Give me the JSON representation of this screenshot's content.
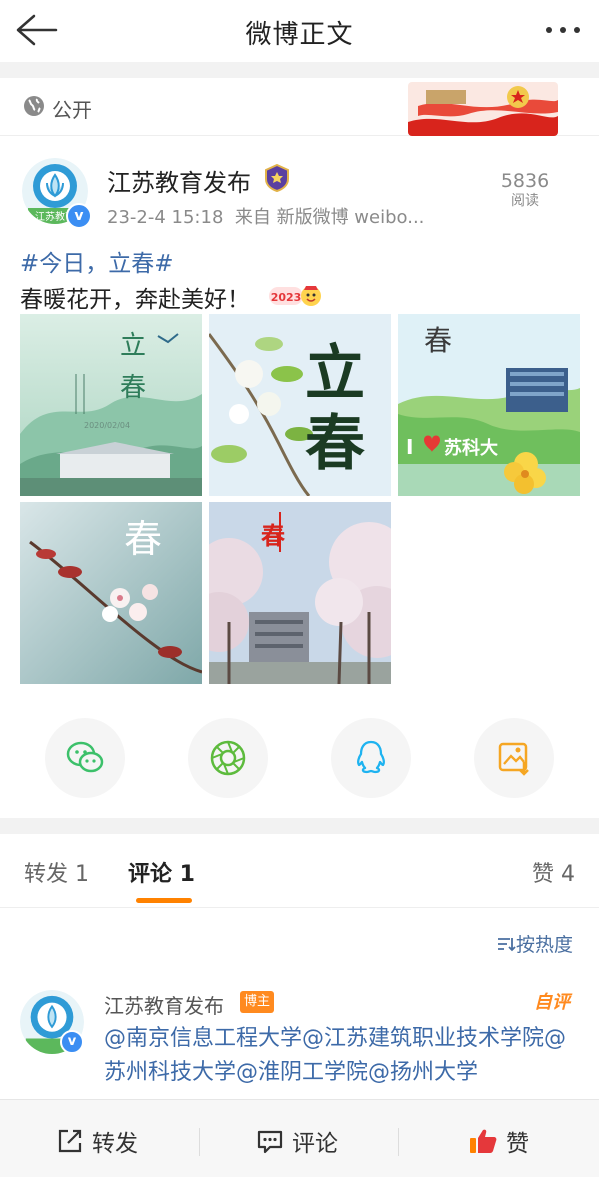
{
  "nav": {
    "title": "微博正文"
  },
  "visibility": {
    "label": "公开"
  },
  "post": {
    "author": "江苏教育发布",
    "avatar_text": "江苏教育",
    "time": "23-2-4 15:18",
    "source": "来自 新版微博 weibo...",
    "views_count": "5836",
    "views_label": "阅读",
    "topic": "#今日，立春#",
    "text": "春暖花开，奔赴美好！",
    "images": [
      {
        "big": "立",
        "big2": "春",
        "small": "2020/02/04"
      },
      {
        "big": "立",
        "big2": "春"
      },
      {
        "big": "春",
        "overlay": "苏科大"
      },
      {
        "big": "春"
      },
      {
        "big": "春"
      }
    ]
  },
  "share": [
    "wechat-icon",
    "moments-icon",
    "qq-icon",
    "save-image-icon"
  ],
  "tabs": {
    "repost": "转发 1",
    "comment": "评论 1",
    "like": "赞 4"
  },
  "sort_label": "按热度",
  "comment": {
    "author": "江苏教育发布",
    "badge": "博主",
    "self_label": "自评",
    "text": "@南京信息工程大学@江苏建筑职业技术学院@苏州科技大学@淮阴工学院@扬州大学"
  },
  "bottom": {
    "repost": "转发",
    "comment": "评论",
    "like": "赞"
  },
  "colors": {
    "accent": "#ff8200",
    "link": "#3d6aa8",
    "verified": "#3b8ef3"
  }
}
